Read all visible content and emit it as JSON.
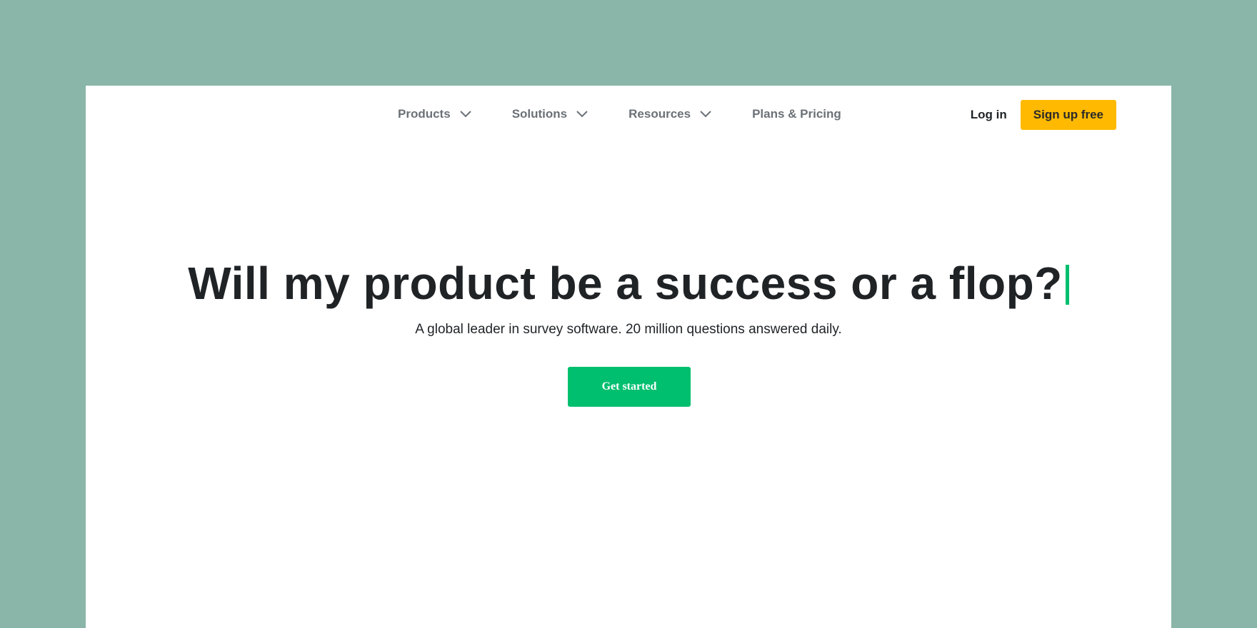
{
  "nav": {
    "items": [
      {
        "label": "Products",
        "has_dropdown": true
      },
      {
        "label": "Solutions",
        "has_dropdown": true
      },
      {
        "label": "Resources",
        "has_dropdown": true
      },
      {
        "label": "Plans & Pricing",
        "has_dropdown": false
      }
    ],
    "login_label": "Log in",
    "signup_label": "Sign up free",
    "dropdown_icon": "chevron-down-icon"
  },
  "hero": {
    "title": "Will my product be a success or a flop?",
    "subtitle": "A global leader in survey software. 20 million questions answered daily.",
    "cta_label": "Get started"
  },
  "colors": {
    "backdrop": "#89b6a8",
    "page_background": "#ffffff",
    "brand_green": "#00bf6f",
    "signup_yellow": "#ffb900",
    "nav_text": "#6b7177",
    "heading_text": "#1f2326"
  }
}
